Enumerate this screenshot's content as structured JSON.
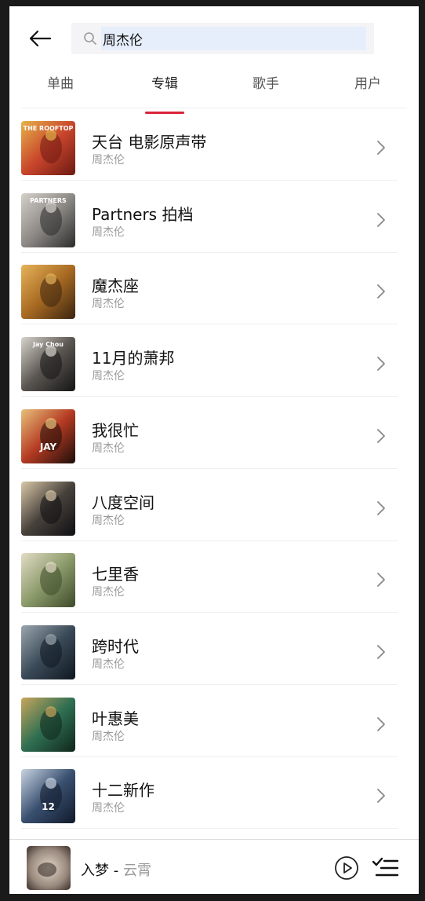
{
  "search": {
    "query": "周杰伦",
    "placeholder": ""
  },
  "tabs": [
    {
      "label": "单曲",
      "active": false
    },
    {
      "label": "专辑",
      "active": true
    },
    {
      "label": "歌手",
      "active": false
    },
    {
      "label": "用户",
      "active": false
    }
  ],
  "albums": [
    {
      "title": "天台 电影原声带",
      "artist": "周杰伦",
      "cover_colors": [
        "#6d1a14",
        "#c9462b",
        "#e7b24a"
      ],
      "cover_text": "THE ROOFTOP"
    },
    {
      "title": "Partners 拍档",
      "artist": "周杰伦",
      "cover_colors": [
        "#2b2b2b",
        "#8d8a86",
        "#d4d0ca"
      ],
      "cover_text": "PARTNERS"
    },
    {
      "title": "魔杰座",
      "artist": "周杰伦",
      "cover_colors": [
        "#3b2410",
        "#a86a22",
        "#e6b35a"
      ]
    },
    {
      "title": "11月的萧邦",
      "artist": "周杰伦",
      "cover_colors": [
        "#151515",
        "#5a5550",
        "#d8d4cd"
      ],
      "cover_text": "Jay Chou"
    },
    {
      "title": "我很忙",
      "artist": "周杰伦",
      "cover_colors": [
        "#1c0e0a",
        "#b43a22",
        "#e8c07a"
      ],
      "cover_text": "JAY"
    },
    {
      "title": "八度空间",
      "artist": "周杰伦",
      "cover_colors": [
        "#0f0f12",
        "#48423c",
        "#d9c8a8"
      ]
    },
    {
      "title": "七里香",
      "artist": "周杰伦",
      "cover_colors": [
        "#3e4a2a",
        "#8c9b6b",
        "#e3dcc6"
      ]
    },
    {
      "title": "跨时代",
      "artist": "周杰伦",
      "cover_colors": [
        "#0f1720",
        "#3b4a58",
        "#9aa6ae"
      ]
    },
    {
      "title": "叶惠美",
      "artist": "周杰伦",
      "cover_colors": [
        "#10261c",
        "#2f6f52",
        "#c9a65c"
      ]
    },
    {
      "title": "十二新作",
      "artist": "周杰伦",
      "cover_colors": [
        "#101a2a",
        "#3a5070",
        "#c8d4e2"
      ],
      "cover_text": "12"
    }
  ],
  "player": {
    "title": "入梦",
    "separator": " - ",
    "artist": "云霄",
    "cover_colors": [
      "#3a2f2a",
      "#9a8a7e",
      "#e2d6c8"
    ]
  },
  "colors": {
    "accent": "#d8243a"
  },
  "icons": {
    "back": "arrow-left-icon",
    "search": "magnifier-icon",
    "chevron": "chevron-right-icon",
    "play": "play-circle-icon",
    "playlist": "playlist-icon"
  }
}
